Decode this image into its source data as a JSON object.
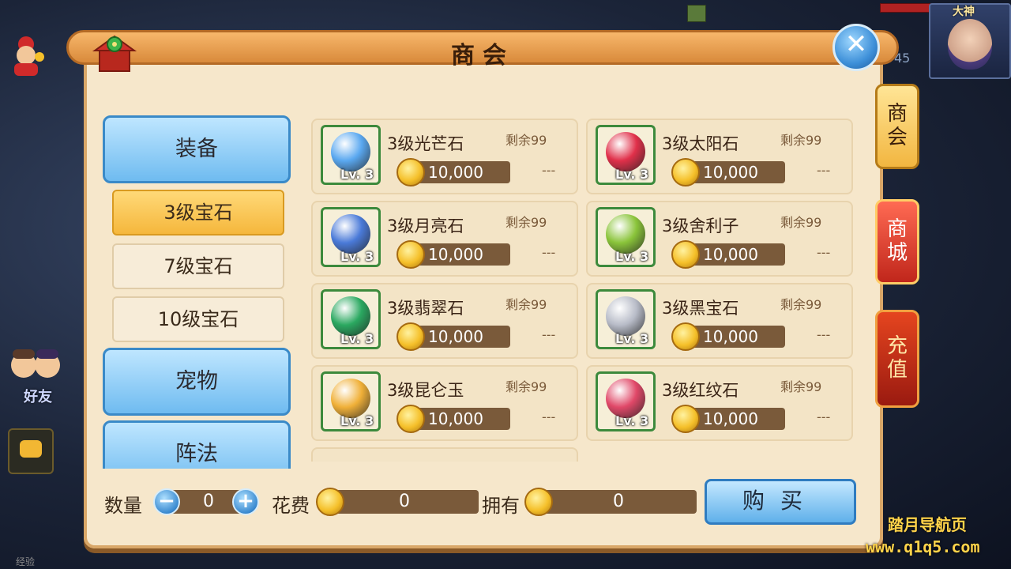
{
  "hud": {
    "player_name": "大神",
    "level_partial": "45",
    "friends_label": "好友",
    "exp_label": "经验"
  },
  "dialog": {
    "title": "商会",
    "close_label": "✕"
  },
  "side_tabs": [
    {
      "label": "商会"
    },
    {
      "label": "商城"
    },
    {
      "label": "充值"
    }
  ],
  "categories": {
    "equipment": "装备",
    "sub_items": [
      "3级宝石",
      "7级宝石",
      "10级宝石"
    ],
    "pet": "宠物",
    "formation": "阵法"
  },
  "items": [
    {
      "name": "3级光芒石",
      "remaining": "剩余99",
      "level": "Lv. 3",
      "price": "10,000",
      "dash": "---",
      "color": "#5aa8f0"
    },
    {
      "name": "3级太阳石",
      "remaining": "剩余99",
      "level": "Lv. 3",
      "price": "10,000",
      "dash": "---",
      "color": "#e0304a"
    },
    {
      "name": "3级月亮石",
      "remaining": "剩余99",
      "level": "Lv. 3",
      "price": "10,000",
      "dash": "---",
      "color": "#4a7ad8"
    },
    {
      "name": "3级舍利子",
      "remaining": "剩余99",
      "level": "Lv. 3",
      "price": "10,000",
      "dash": "---",
      "color": "#8ac43a"
    },
    {
      "name": "3级翡翠石",
      "remaining": "剩余99",
      "level": "Lv. 3",
      "price": "10,000",
      "dash": "---",
      "color": "#2aa860"
    },
    {
      "name": "3级黑宝石",
      "remaining": "剩余99",
      "level": "Lv. 3",
      "price": "10,000",
      "dash": "---",
      "color": "#b8bcc8"
    },
    {
      "name": "3级昆仑玉",
      "remaining": "剩余99",
      "level": "Lv. 3",
      "price": "10,000",
      "dash": "---",
      "color": "#f0b038"
    },
    {
      "name": "3级红纹石",
      "remaining": "剩余99",
      "level": "Lv. 3",
      "price": "10,000",
      "dash": "---",
      "color": "#e04868"
    }
  ],
  "bottom": {
    "quantity_label": "数量",
    "quantity_value": "0",
    "minus": "−",
    "plus": "+",
    "cost_label": "花费",
    "cost_value": "0",
    "owned_label": "拥有",
    "owned_value": "0",
    "buy_label": "购买"
  },
  "watermark": {
    "line1": "踏月导航页",
    "line2": "www.q1q5.com"
  }
}
